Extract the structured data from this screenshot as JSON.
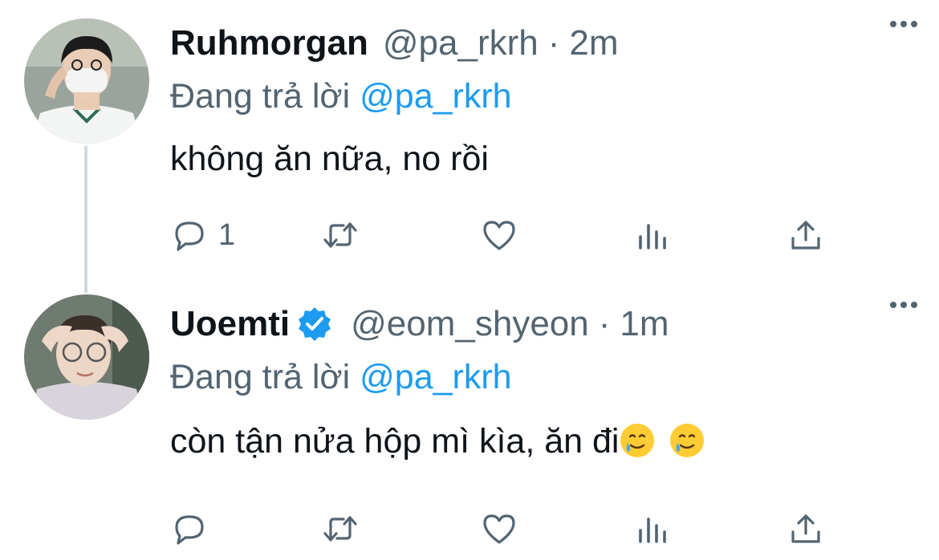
{
  "tweets": [
    {
      "name": "Ruhmorgan",
      "verified": false,
      "handle": "@pa_rkrh",
      "separator": "·",
      "time": "2m",
      "replying_prefix": "Đang trả lời",
      "replying_to": "@pa_rkrh",
      "text": "không ăn nữa, no rồi",
      "reply_count": "1",
      "avatar": "avatar-masked-person"
    },
    {
      "name": "Uoemti",
      "verified": true,
      "handle": "@eom_shyeon",
      "separator": "·",
      "time": "1m",
      "replying_prefix": "Đang trả lời",
      "replying_to": "@pa_rkrh",
      "text": "còn tận nửa hộp mì kìa, ăn đi",
      "emojis": [
        "smiling-face-with-tear-emoji",
        "smiling-face-with-tear-emoji"
      ],
      "reply_count": "",
      "avatar": "avatar-person-glasses"
    }
  ],
  "icons": [
    "reply-icon",
    "retweet-icon",
    "like-icon",
    "views-icon",
    "share-icon",
    "more-options-icon",
    "verified-badge-icon"
  ],
  "colors": {
    "text": "#0f1419",
    "muted": "#536471",
    "accent": "#1d9bf0",
    "thread": "#cfd9de"
  }
}
